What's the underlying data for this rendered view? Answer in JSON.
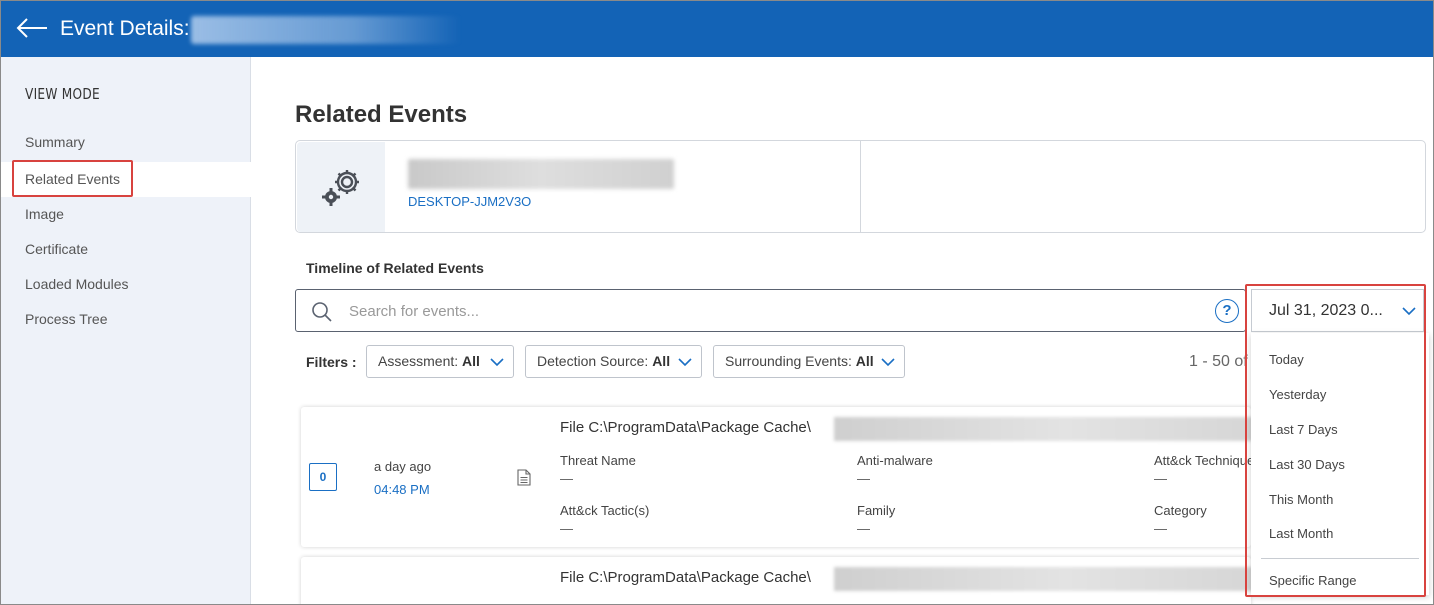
{
  "header": {
    "title": "Event Details:"
  },
  "sidebar": {
    "heading": "VIEW MODE",
    "items": [
      {
        "label": "Summary"
      },
      {
        "label": "Related Events"
      },
      {
        "label": "Image"
      },
      {
        "label": "Certificate"
      },
      {
        "label": "Loaded Modules"
      },
      {
        "label": "Process Tree"
      }
    ],
    "active_index": 1
  },
  "main": {
    "title": "Related Events",
    "device": {
      "hostname": "DESKTOP-JJM2V3O"
    },
    "timeline_label": "Timeline of Related Events",
    "search": {
      "placeholder": "Search for events...",
      "help": "?"
    },
    "date_filter": {
      "value": "Jul 31, 2023 0..."
    },
    "filters": {
      "label": "Filters :",
      "items": [
        {
          "name": "Assessment:",
          "value": "All"
        },
        {
          "name": "Detection Source:",
          "value": "All"
        },
        {
          "name": "Surrounding Events:",
          "value": "All"
        }
      ]
    },
    "range_text": "1 - 50 of",
    "events": [
      {
        "count": "0",
        "ago": "a day ago",
        "time": "04:48 PM",
        "path": "File C:\\ProgramData\\Package Cache\\",
        "fields": [
          {
            "label": "Threat Name",
            "value": "—"
          },
          {
            "label": "Anti-malware",
            "value": "—"
          },
          {
            "label": "Att&ck Technique",
            "value": "—"
          },
          {
            "label": "Att&ck Tactic(s)",
            "value": "—"
          },
          {
            "label": "Family",
            "value": "—"
          },
          {
            "label": "Category",
            "value": "—"
          }
        ]
      },
      {
        "path": "File C:\\ProgramData\\Package Cache\\"
      }
    ]
  },
  "date_dropdown": {
    "options": [
      {
        "label": "Today"
      },
      {
        "label": "Yesterday"
      },
      {
        "label": "Last 7 Days"
      },
      {
        "label": "Last 30 Days"
      },
      {
        "label": "This Month"
      },
      {
        "label": "Last Month"
      }
    ],
    "custom_option": "Specific Range"
  },
  "colors": {
    "header_bg": "#1363b6",
    "sidebar_bg": "#eef2f9",
    "link": "#1a6fc4",
    "highlight_box": "#d8433f"
  }
}
